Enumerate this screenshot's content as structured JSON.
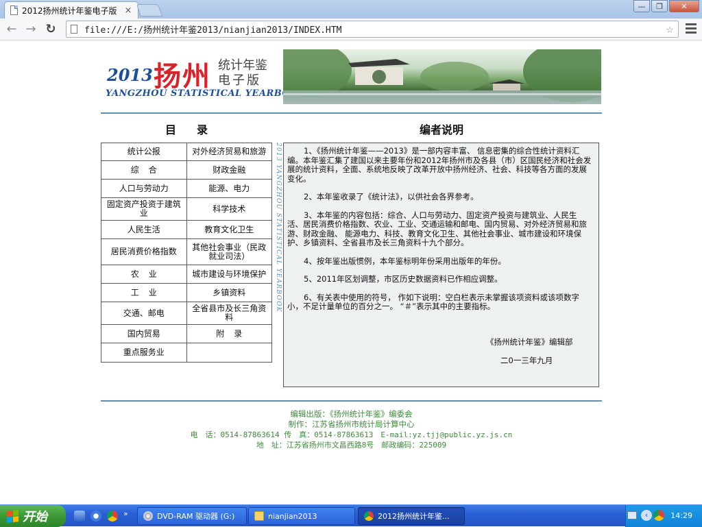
{
  "browser": {
    "tab_title": "2012扬州统计年鉴电子版",
    "tab_close": "×",
    "url": "file:///E:/扬州统计年鉴2013/nianjian2013/INDEX.HTM",
    "back_icon": "←",
    "forward_icon": "→",
    "reload_icon": "↻",
    "star_icon": "☆",
    "minimize": "—",
    "maximize": "❐",
    "close": "✕"
  },
  "banner": {
    "year": "2013",
    "city": "扬州",
    "sub1": "统计年鉴",
    "sub2": "电子版",
    "english": "YANGZHOU STATISTICAL YEARBOOK"
  },
  "toc": {
    "title": "目录",
    "rows": [
      [
        "统计公报",
        "对外经济贸易和旅游"
      ],
      [
        "综合",
        "财政金融"
      ],
      [
        "人口与劳动力",
        "能源、电力"
      ],
      [
        "固定资产投资于建筑业",
        "科学技术"
      ],
      [
        "人民生活",
        "教育文化卫生"
      ],
      [
        "居民消费价格指数",
        "其他社会事业（民政就业司法）"
      ],
      [
        "农业",
        "城市建设与环境保护"
      ],
      [
        "工业",
        "乡镇资料"
      ],
      [
        "交通、邮电",
        "全省县市及长三角资料"
      ],
      [
        "国内贸易",
        "附录"
      ],
      [
        "重点服务业",
        ""
      ]
    ],
    "vertical_caption": "2013 YANGZHOU STATISTICAL YEARBOOK"
  },
  "editor": {
    "title": "编者说明",
    "paragraphs": [
      "1、《扬州统计年鉴——2013》是一部内容丰富、 信息密集的综合性统计资料汇编。本年鉴汇集了建国以来主要年份和2012年扬州市及各县（市）区国民经济和社会发展的统计资料，全面、系统地反映了改革开放中扬州经济、社会、科技等各方面的发展变化。",
      "2、本年鉴收录了《统计法》，以供社会各界参考。",
      "3、本年鉴的内容包括：综合、人口与劳动力、固定资产投资与建筑业、人民生活、居民消费价格指数、农业、工业、交通运输和邮电、国内贸易、对外经济贸易和旅游、财政金融、 能源电力、科技、教育文化卫生、其他社会事业、城市建设和环境保护、乡镇资料、全省县市及长三角资料十九个部分。",
      "4、按年鉴出版惯例，本年鉴标明年份采用出版年的年份。",
      "5、2011年区划调整，市区历史数据资料已作相应调整。",
      "6、有关表中使用的符号， 作如下说明：空白栏表示未掌握该项资料或该项数字小，不足计量单位的百分之一。 “＃”表示其中的主要指标。"
    ],
    "signature_org": "《扬州统计年鉴》编辑部",
    "signature_date": "二0一三年九月"
  },
  "footer": {
    "line1": "编辑出版：《扬州统计年鉴》编委会",
    "line2": "制作：江苏省扬州市统计局计算中心",
    "line3": "电　话：0514-87863614 传　真：0514-87863613　E-mail:yz.tjj@public.yz.js.cn",
    "line4": "地　址：江苏省扬州市文昌西路8号　邮政编码：225009"
  },
  "taskbar": {
    "start_label": "开始",
    "tasks": [
      {
        "label": "DVD-RAM 驱动器 (G:)",
        "active": false
      },
      {
        "label": "nianjian2013",
        "active": false
      },
      {
        "label": "2012扬州统计年鉴...",
        "active": true
      }
    ],
    "clock": "14:29"
  },
  "colors": {
    "rule": "#5b90b5",
    "footer_text": "#3e8a3a",
    "logo_red": "#d8232a",
    "logo_blue": "#1b4f9c"
  }
}
